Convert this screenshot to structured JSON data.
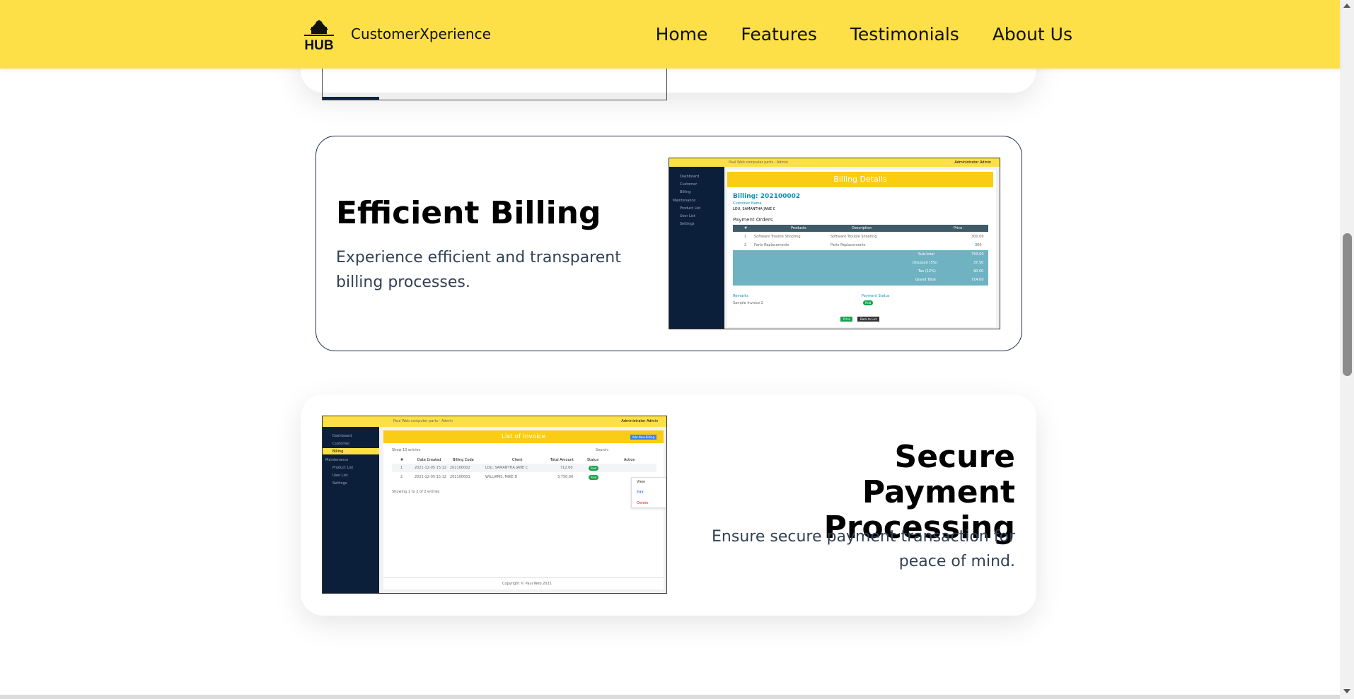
{
  "brand": {
    "logo_text": "HUB",
    "name": "CustomerXperience"
  },
  "nav": {
    "items": [
      "Home",
      "Features",
      "Testimonials",
      "About Us"
    ]
  },
  "features": [
    {
      "title": "Efficient Billing",
      "description": "Experience efficient and transparent billing processes.",
      "screenshot": {
        "header": "Billing Details",
        "billing_label": "Billing: 202100002",
        "customer_label": "Customer Name",
        "customer_value": "LOU, SAMANTHA JANE C",
        "section": "Payment Orders",
        "columns": [
          "#",
          "Products",
          "Description",
          "Price"
        ],
        "rows": [
          [
            "1",
            "Software Trouble Shooting",
            "Software Trouble Shooting",
            "300.00"
          ],
          [
            "2",
            "Parts Replacements",
            "Parts Replacements",
            "300"
          ]
        ],
        "totals": [
          [
            "Sub-total",
            "750.00"
          ],
          [
            "Discount (5%)",
            "37.50"
          ],
          [
            "Tax (12%)",
            "90.00"
          ],
          [
            "Grand Total",
            "714.00"
          ]
        ],
        "remarks_label": "Remarks",
        "remarks_value": "Sample Invoice 2",
        "status_label": "Payment Status",
        "status_value": "Paid",
        "buttons": [
          "Print",
          "Back to List"
        ],
        "admin": "Administrator Admin"
      }
    },
    {
      "title": "Secure Payment Processing",
      "description": "Ensure secure payment transaction for peace of mind.",
      "screenshot": {
        "header": "List of Invoice",
        "add_button": "Add New Billing",
        "columns": [
          "#",
          "Date Created",
          "Billing Code",
          "Client",
          "Total Amount",
          "Status",
          "Action"
        ],
        "rows": [
          [
            "1",
            "2021-12-05 15:12",
            "202100002",
            "LOU, SAMANTHA JANE C",
            "712.00",
            "Paid"
          ],
          [
            "2",
            "2021-12-05 15:12",
            "202100001",
            "WILLIAMS, MIKE D",
            "3,750.00",
            "Paid"
          ]
        ],
        "footer_text": "Showing 1 to 2 of 2 entries",
        "menu": [
          "View",
          "Edit",
          "Delete"
        ],
        "copyright": "Copyright © Paul Web 2021",
        "admin": "Administrator Admin"
      }
    }
  ]
}
